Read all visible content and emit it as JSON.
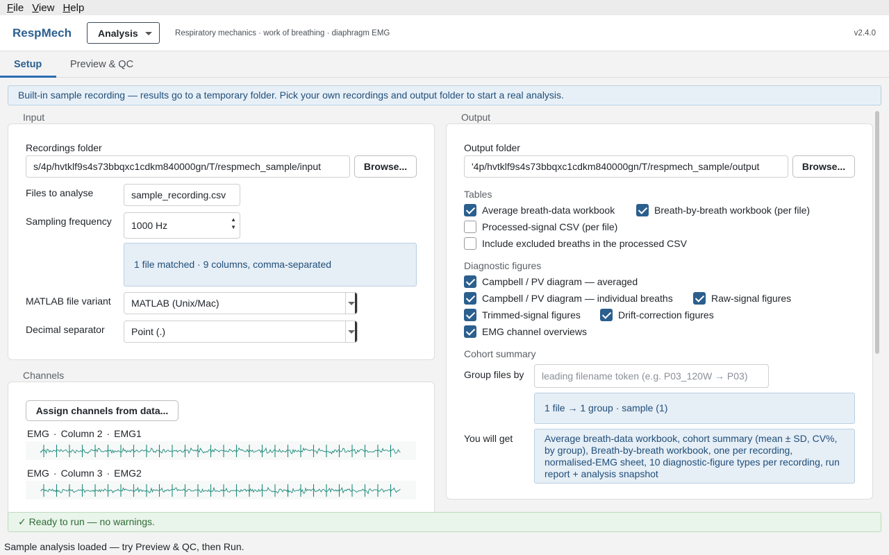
{
  "menu": {
    "items": [
      {
        "label": "File",
        "underline": "F",
        "rest": "ile"
      },
      {
        "label": "View",
        "underline": "V",
        "rest": "iew"
      },
      {
        "label": "Help",
        "underline": "H",
        "rest": "elp"
      }
    ]
  },
  "header": {
    "app_name": "RespMech",
    "mode_value": "Analysis",
    "subtitle": "Respiratory mechanics · work of breathing · diaphragm EMG",
    "version": "v2.4.0"
  },
  "tabs": [
    {
      "label": "Setup",
      "active": true
    },
    {
      "label": "Preview & QC",
      "active": false
    }
  ],
  "banner": "Built-in sample recording — results go to a temporary folder. Pick your own recordings and output folder to start a real analysis.",
  "input": {
    "section_title": "Input",
    "recordings_folder_label": "Recordings folder",
    "recordings_folder_value": "s/4p/hvtklf9s4s73bbqxc1cdkm840000gn/T/respmech_sample/input",
    "browse_label": "Browse...",
    "files_label": "Files to analyse",
    "files_value": "sample_recording.csv",
    "sampling_label": "Sampling frequency",
    "sampling_value": "1000 Hz",
    "match_info": "1 file matched · 9 columns, comma-separated",
    "matlab_label": "MATLAB file variant",
    "matlab_value": "MATLAB (Unix/Mac)",
    "decimal_label": "Decimal separator",
    "decimal_value": "Point (.)"
  },
  "channels": {
    "section_title": "Channels",
    "assign_button": "Assign channels from data...",
    "list": [
      {
        "type": "EMG",
        "column": "Column 2",
        "name": "EMG1"
      },
      {
        "type": "EMG",
        "column": "Column 3",
        "name": "EMG2"
      }
    ],
    "sep": "·"
  },
  "output": {
    "section_title": "Output",
    "folder_label": "Output folder",
    "folder_value": "'4p/hvtklf9s4s73bbqxc1cdkm840000gn/T/respmech_sample/output",
    "browse_label": "Browse...",
    "tables_heading": "Tables",
    "tables": [
      {
        "label": "Average breath-data workbook",
        "checked": true
      },
      {
        "label": "Breath-by-breath workbook (per file)",
        "checked": true
      },
      {
        "label": "Processed-signal CSV (per file)",
        "checked": false
      },
      {
        "label": "Include excluded breaths in the processed CSV",
        "checked": false
      }
    ],
    "figures_heading": "Diagnostic figures",
    "figures": [
      {
        "label": "Campbell / PV diagram — averaged",
        "checked": true
      },
      {
        "label": "Campbell / PV diagram — individual breaths",
        "checked": true
      },
      {
        "label": "Raw-signal figures",
        "checked": true
      },
      {
        "label": "Trimmed-signal figures",
        "checked": true
      },
      {
        "label": "Drift-correction figures",
        "checked": true
      },
      {
        "label": "EMG channel overviews",
        "checked": true
      }
    ],
    "cohort_heading": "Cohort summary",
    "group_label": "Group files by",
    "group_placeholder": "leading filename token (e.g. P03_120W → P03)",
    "group_info": "1 file → 1 group · sample (1)",
    "you_get_label": "You will get",
    "you_get_text": "Average breath-data workbook, cohort summary (mean ± SD, CV%, by group), Breath-by-breath workbook, one per recording, normalised-EMG sheet, 10 diagnostic-figure types per recording, run report + analysis snapshot"
  },
  "status": {
    "ready": "✓  Ready to run — no warnings.",
    "footer": "Sample analysis loaded — try Preview & QC, then Run."
  },
  "colors": {
    "accent": "#2b5f8e",
    "wave": "#1a8a7a",
    "ok": "#2e6b36"
  }
}
